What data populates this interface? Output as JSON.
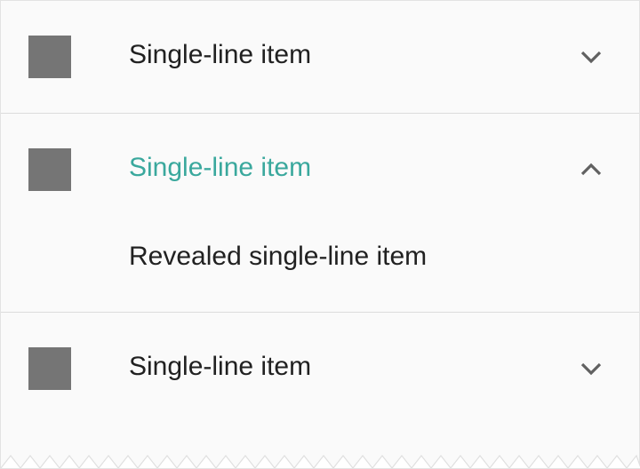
{
  "colors": {
    "background": "#fafafa",
    "text": "#212121",
    "accent": "#3aa89d",
    "avatar": "#757575",
    "divider": "#dcdcdc",
    "icon": "#616161"
  },
  "items": [
    {
      "label": "Single-line item",
      "expanded": false,
      "icon": "chevron-down-icon"
    },
    {
      "label": "Single-line item",
      "expanded": true,
      "icon": "chevron-up-icon",
      "revealed": {
        "label": "Revealed single-line item"
      }
    },
    {
      "label": "Single-line item",
      "expanded": false,
      "icon": "chevron-down-icon"
    }
  ]
}
